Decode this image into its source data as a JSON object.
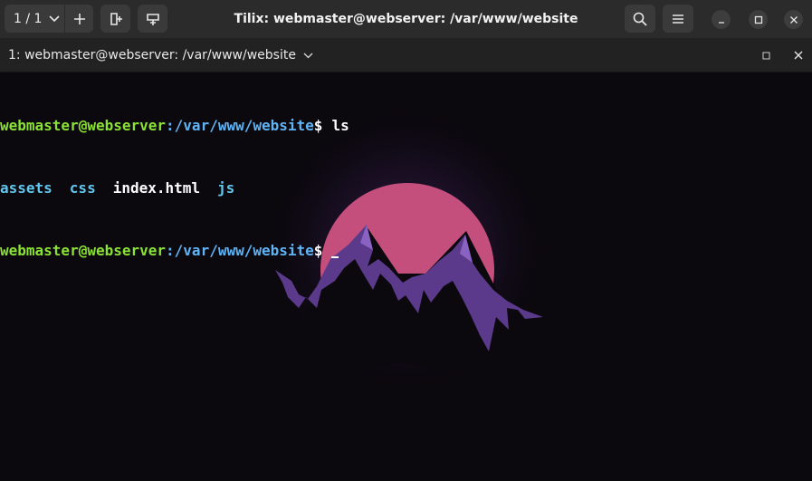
{
  "window": {
    "title": "Tilix: webmaster@webserver: /var/www/website"
  },
  "header": {
    "session_counter": "1 / 1"
  },
  "tab": {
    "title": "1: webmaster@webserver: /var/www/website"
  },
  "terminal": {
    "prompt_user_host": "webmaster@webserver",
    "prompt_path": ":/var/www/website",
    "prompt_symbol": "$",
    "command": "ls",
    "ls_output": [
      {
        "name": "assets",
        "kind": "directory"
      },
      {
        "name": "css",
        "kind": "directory"
      },
      {
        "name": "index.html",
        "kind": "file"
      },
      {
        "name": "js",
        "kind": "directory"
      }
    ]
  },
  "colors": {
    "prompt_user": "#8ae234",
    "prompt_path": "#5fb4f5",
    "directory": "#5fc6ec",
    "file": "#ffffff",
    "background": "#0b080e",
    "sun": "#c44f7c",
    "mountain": "#5b3a8c"
  },
  "icons": [
    "chevron-down-icon",
    "plus-icon",
    "add-terminal-right-icon",
    "add-terminal-down-icon",
    "search-icon",
    "hamburger-menu-icon",
    "minimize-icon",
    "maximize-icon",
    "close-icon"
  ]
}
